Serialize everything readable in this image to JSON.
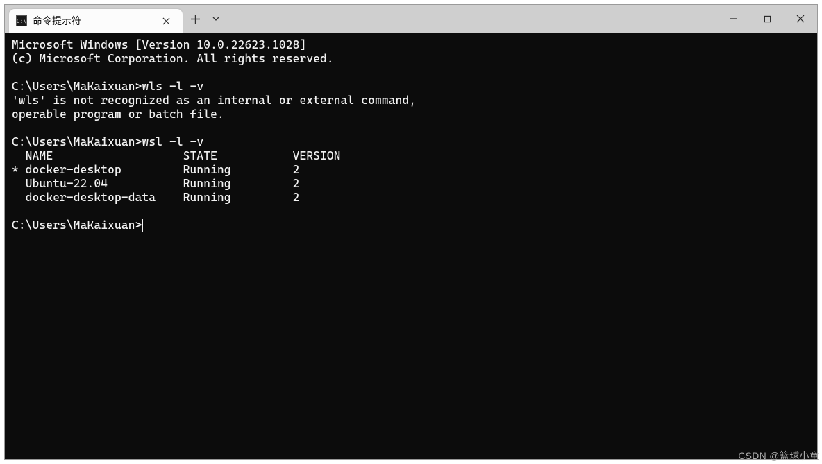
{
  "tab": {
    "title": "命令提示符",
    "icon_label": "C:\\"
  },
  "terminal": {
    "banner_line1": "Microsoft Windows [Version 10.0.22623.1028]",
    "banner_line2": "(c) Microsoft Corporation. All rights reserved.",
    "prompt1": "C:\\Users\\MaKaixuan>",
    "cmd1": "wls -l -v",
    "err1_line1": "'wls' is not recognized as an internal or external command,",
    "err1_line2": "operable program or batch file.",
    "prompt2": "C:\\Users\\MaKaixuan>",
    "cmd2": "wsl -l -v",
    "wsl_header": "  NAME                   STATE           VERSION",
    "wsl_rows": [
      "* docker-desktop         Running         2",
      "  Ubuntu-22.04           Running         2",
      "  docker-desktop-data    Running         2"
    ],
    "prompt3": "C:\\Users\\MaKaixuan>"
  },
  "watermark": "CSDN @篮球小童"
}
